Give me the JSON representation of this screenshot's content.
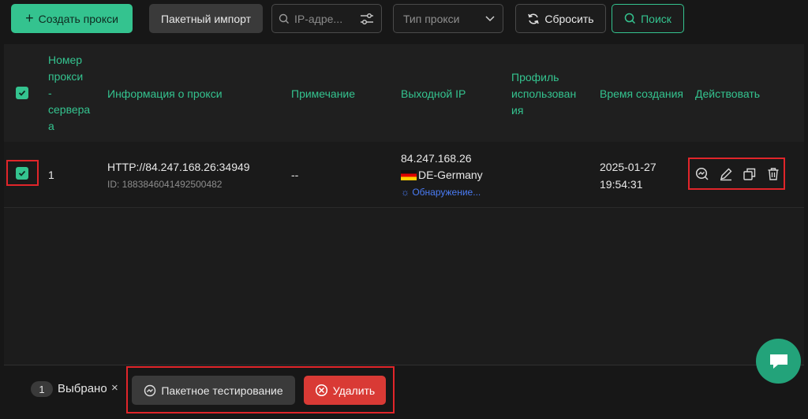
{
  "toolbar": {
    "create_label": "Создать прокси",
    "import_label": "Пакетный импорт",
    "search_placeholder": "IP-адре...",
    "proxy_type_placeholder": "Тип прокси",
    "reset_label": "Сбросить",
    "search_label": "Поиск"
  },
  "table": {
    "headers": {
      "number": [
        "Номер",
        "прокси",
        "-",
        "сервера",
        "а"
      ],
      "info": "Информация о прокси",
      "note": "Примечание",
      "exit_ip": "Выходной IP",
      "profile": [
        "Профиль",
        "использован",
        "ия"
      ],
      "created": "Время создания",
      "actions": "Действовать"
    },
    "rows": [
      {
        "number": "1",
        "proxy": "HTTP://84.247.168.26:34949",
        "id": "ID: 1883846041492500482",
        "note": "--",
        "exit_ip": "84.247.168.26",
        "country": "DE-Germany",
        "detect_status": "Обнаружение...",
        "created_date": "2025-01-27",
        "created_time": "19:54:31"
      }
    ]
  },
  "footer": {
    "selected_count": "1",
    "selected_label": "Выбрано",
    "clear_symbol": "×",
    "batch_test_label": "Пакетное тестирование",
    "delete_label": "Удалить"
  },
  "colors": {
    "accent": "#34c38f",
    "danger": "#d93a35",
    "highlight": "#e1252a",
    "link": "#4a7cf5"
  }
}
